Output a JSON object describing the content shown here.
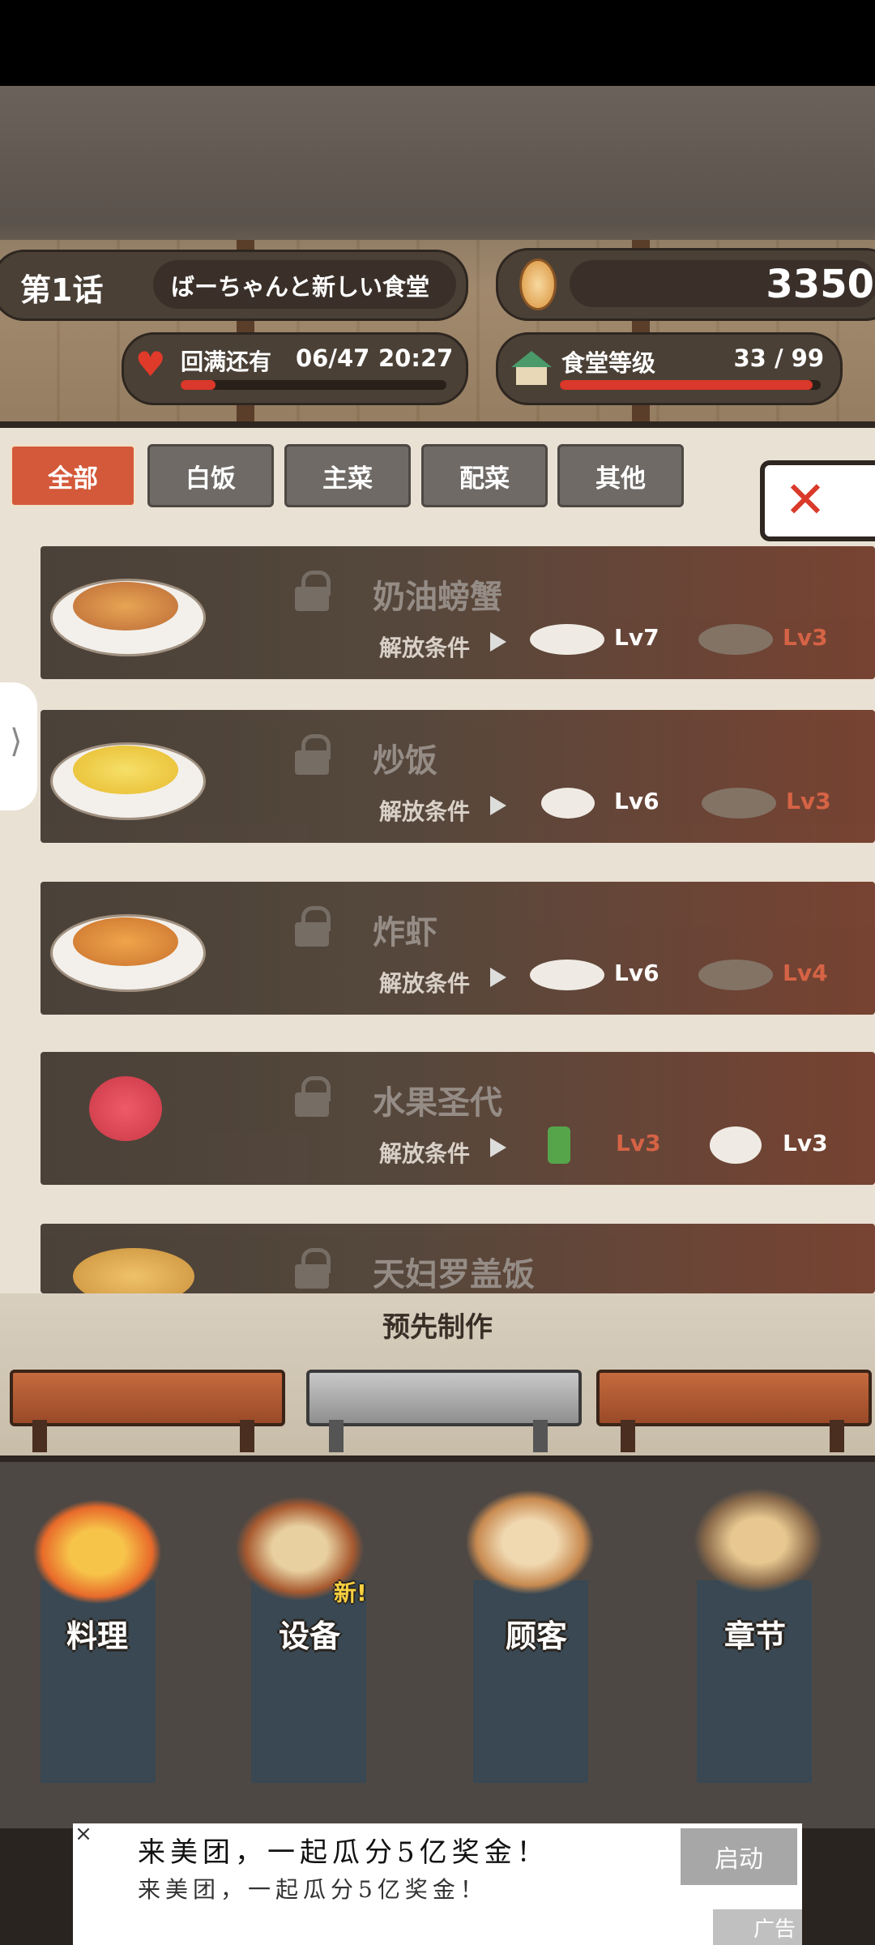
{
  "header": {
    "chapter": "第1话",
    "chapter_subtitle": "ばーちゃんと新しい食堂",
    "coins": "3350",
    "recover_label": "回满还有",
    "recover_count": "06/47",
    "recover_timer": "20:27",
    "recover_progress": 0.13,
    "level_label": "食堂等级",
    "level_value": "33 / 99",
    "level_progress": 0.97
  },
  "tabs": [
    {
      "label": "全部",
      "active": true
    },
    {
      "label": "白饭"
    },
    {
      "label": "主菜"
    },
    {
      "label": "配菜"
    },
    {
      "label": "其他"
    }
  ],
  "unlock_label": "解放条件",
  "recipes": [
    {
      "name": "奶油螃蟹",
      "food_icon": "crab-croquette-icon",
      "req": [
        {
          "icon": "fried-croquette-icon",
          "lv": "Lv7",
          "met": true
        },
        {
          "icon": "curry-icon",
          "lv": "Lv3",
          "met": false
        }
      ]
    },
    {
      "name": "炒饭",
      "food_icon": "fried-rice-icon",
      "req": [
        {
          "icon": "white-rice-icon",
          "lv": "Lv6",
          "met": true
        },
        {
          "icon": "gyoza-icon",
          "lv": "Lv3",
          "met": false
        }
      ]
    },
    {
      "name": "炸虾",
      "food_icon": "fried-shrimp-icon",
      "req": [
        {
          "icon": "karaage-icon",
          "lv": "Lv6",
          "met": true
        },
        {
          "icon": "meatball-icon",
          "lv": "Lv4",
          "met": false
        }
      ]
    },
    {
      "name": "水果圣代",
      "food_icon": "fruit-sundae-icon",
      "req": [
        {
          "icon": "green-drink-icon",
          "lv": "Lv3",
          "met": false
        },
        {
          "icon": "fruit-bowl-icon",
          "lv": "Lv3",
          "met": true
        }
      ]
    },
    {
      "name": "天妇罗盖饭",
      "food_icon": "tempura-bowl-icon",
      "req": []
    }
  ],
  "premake": {
    "title": "预先制作"
  },
  "bottom_menu": [
    {
      "label": "料理",
      "icon": "cooking-pot-icon"
    },
    {
      "label": "设备",
      "icon": "restaurant-building-icon",
      "badge": "新!"
    },
    {
      "label": "顾客",
      "icon": "customers-icon"
    },
    {
      "label": "章节",
      "icon": "film-projector-icon"
    }
  ],
  "ad": {
    "title": "来美团，一起瓜分5亿奖金！",
    "subtitle": "来美团，一起瓜分5亿奖金！",
    "button": "启动",
    "tag": "广告",
    "close": "×"
  },
  "colors": {
    "accent": "#d4593a",
    "ok": "#ffffff",
    "locked": "#d4593a"
  }
}
